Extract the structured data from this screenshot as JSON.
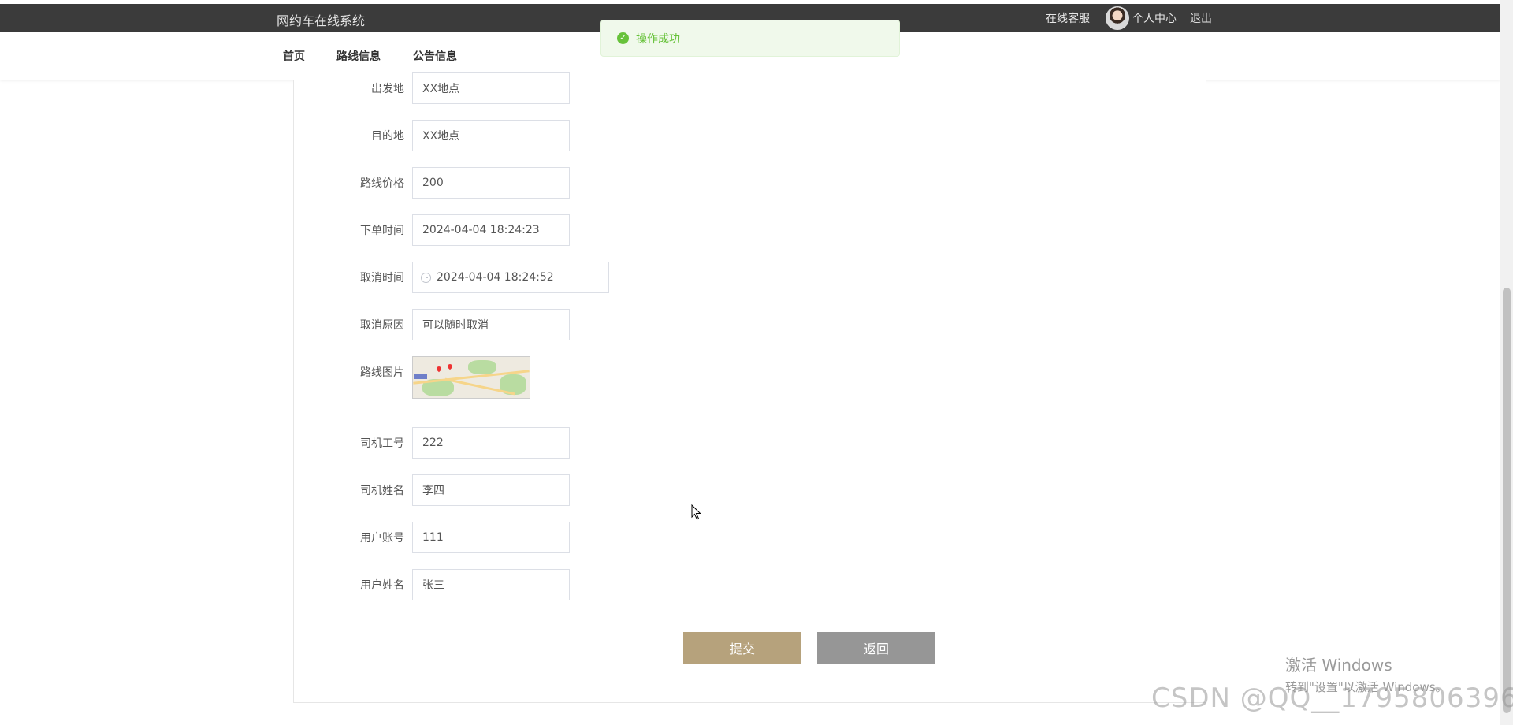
{
  "header": {
    "app_title": "网约车在线系统",
    "online_service": "在线客服",
    "personal_center": "个人中心",
    "logout": "退出"
  },
  "nav": {
    "home": "首页",
    "routes": "路线信息",
    "notices": "公告信息"
  },
  "toast": {
    "message": "操作成功"
  },
  "form": {
    "departure": {
      "label": "出发地",
      "value": "XX地点"
    },
    "destination": {
      "label": "目的地",
      "value": "XX地点"
    },
    "price": {
      "label": "路线价格",
      "value": "200"
    },
    "order_time": {
      "label": "下单时间",
      "value": "2024-04-04 18:24:23"
    },
    "cancel_time": {
      "label": "取消时间",
      "value": "2024-04-04 18:24:52"
    },
    "cancel_reason": {
      "label": "取消原因",
      "value": "可以随时取消"
    },
    "route_image": {
      "label": "路线图片"
    },
    "driver_id": {
      "label": "司机工号",
      "value": "222"
    },
    "driver_name": {
      "label": "司机姓名",
      "value": "李四"
    },
    "user_account": {
      "label": "用户账号",
      "value": "111"
    },
    "user_name": {
      "label": "用户姓名",
      "value": "张三"
    }
  },
  "buttons": {
    "submit": "提交",
    "back": "返回"
  },
  "watermark": {
    "windows_title": "激活 Windows",
    "windows_sub": "转到\"设置\"以激活 Windows。",
    "csdn": "CSDN @QQ__1795806396"
  },
  "colors": {
    "topbar": "#3b3b3b",
    "submit_button": "#b6a27c",
    "back_button": "#969696",
    "success": "#67c23a"
  }
}
